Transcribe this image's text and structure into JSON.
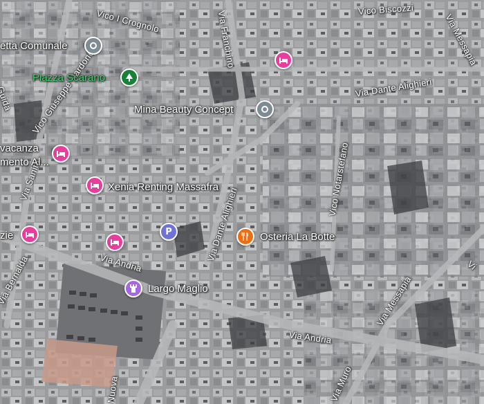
{
  "map": {
    "type": "satellite",
    "colors": {
      "hotel": "#e83e9b",
      "landmark": "#7d8b95",
      "park": "#188038",
      "restaurant": "#ec6e12",
      "attraction": "#a567e2",
      "parking": "#6f73d8"
    }
  },
  "streets": {
    "vico_crognolo": "Vico I Crognolo",
    "via_franchino": "Via Franchino",
    "vico_biscozzi": "Vico Biscozzi",
    "via_messapia_top": "Via Messapia",
    "via_dante_top": "Via Dante Alighieri",
    "vico_nardone": "Vico Giuseppe Nardone",
    "vico_notarstefano": "Vico Notarstefano",
    "via_dante_mid": "Via Dante Alighieri",
    "via_sanita": "Via Sanità",
    "via_andria_left": "Via Andria",
    "via_bernalda": "Via Bernalda",
    "via_andria_bottom": "Via Andria",
    "via_messapia_bottom": "Via Messapia",
    "via_muro": "Via Muro",
    "via_nuova": "Nuova",
    "via_guida": "Guida",
    "via_right": "Vi"
  },
  "pois": {
    "villetta": "etta Comunale",
    "piazza": "Piazza Scarano",
    "mina": "Mina Beauty Concept",
    "vacanza_line1": "vacanza",
    "vacanza_line2": "mento Al...",
    "xenia": "Xenia Renting Massafra",
    "osteria": "Osteria La Botte",
    "largo": "Largo Maglio",
    "zie": "zie"
  },
  "icons": {
    "hotel": "bed-icon",
    "landmark": "circle-dot-icon",
    "park": "tree-icon",
    "restaurant": "fork-knife-icon",
    "attraction": "tower-icon",
    "parking": "parking-icon"
  },
  "parking_glyph": "P"
}
